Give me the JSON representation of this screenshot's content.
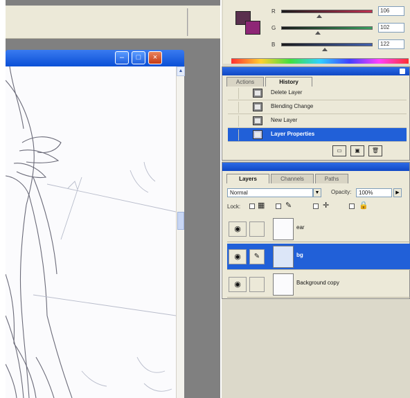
{
  "color_panel": {
    "channels": [
      {
        "label": "R",
        "value": "106",
        "color": "#c03050",
        "level": 0.42
      },
      {
        "label": "G",
        "value": "102",
        "color": "#3aa060",
        "level": 0.4
      },
      {
        "label": "B",
        "value": "122",
        "color": "#4060b0",
        "level": 0.48
      }
    ]
  },
  "history": {
    "tabs": [
      "Actions",
      "History"
    ],
    "items": [
      {
        "label": "Delete Layer"
      },
      {
        "label": "Blending Change"
      },
      {
        "label": "New Layer"
      },
      {
        "label": "Layer Properties"
      }
    ],
    "selected_index": 3,
    "footer_icons": [
      "new-snapshot-icon",
      "new-document-icon",
      "trash-icon"
    ]
  },
  "layers": {
    "tabs": [
      "Layers",
      "Channels",
      "Paths"
    ],
    "blend_mode": "Normal",
    "opacity_label": "Opacity:",
    "opacity_value": "100%",
    "lock_label": "Lock:",
    "rows": [
      {
        "name": "ear"
      },
      {
        "name": "bg"
      },
      {
        "name": "Background copy"
      }
    ],
    "selected_index": 1
  },
  "colors": {
    "accent": "#2160d8",
    "panel_bg": "#ece9d8",
    "workspace": "#808080"
  }
}
